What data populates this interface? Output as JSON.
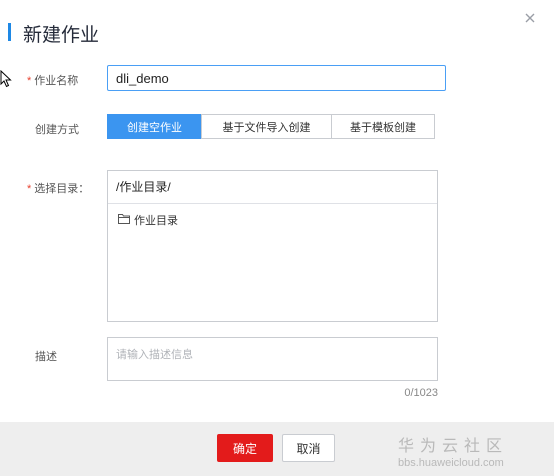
{
  "dialog": {
    "title": "新建作业",
    "close_icon": "close-icon"
  },
  "form": {
    "job_name_label": "作业名称",
    "job_name_value": "dli_demo",
    "create_mode_label": "创建方式",
    "create_mode_options": [
      "创建空作业",
      "基于文件导入创建",
      "基于模板创建"
    ],
    "create_mode_selected": "创建空作业",
    "directory_label": "选择目录：",
    "directory_path": "/作业目录/",
    "directory_tree_item": "作业目录",
    "description_label": "描述",
    "description_placeholder": "请输入描述信息",
    "description_counter": "0/1023"
  },
  "footer": {
    "ok_label": "确定",
    "cancel_label": "取消"
  },
  "watermark": {
    "brand": "华为云社区",
    "url": "bbs.huaweicloud.com"
  },
  "colors": {
    "accent": "#1e88e5",
    "primary_button": "#e31b1b",
    "segment_active": "#3b95f0",
    "required_mark": "#e8402e"
  }
}
